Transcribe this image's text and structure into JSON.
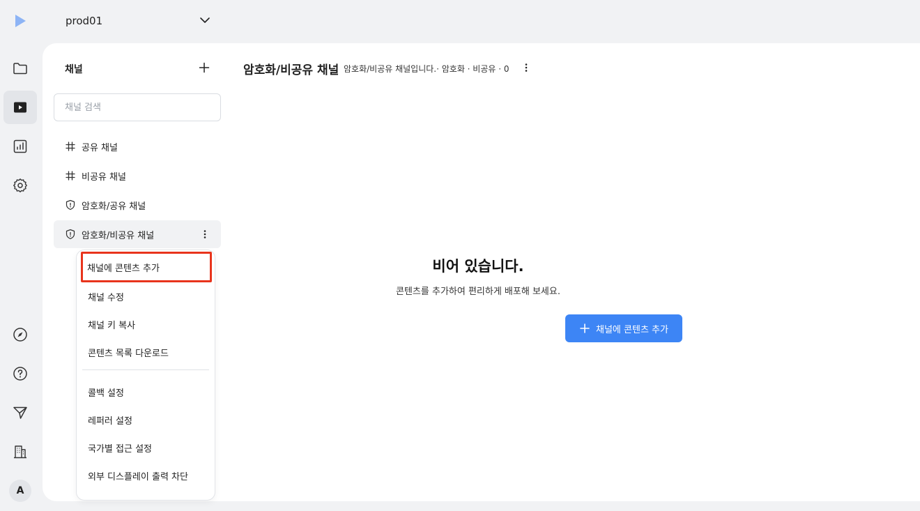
{
  "workspace": {
    "name": "prod01"
  },
  "rail": {
    "items": [
      {
        "icon": "folder-icon"
      },
      {
        "icon": "play-icon",
        "active": true
      },
      {
        "icon": "analytics-icon"
      },
      {
        "icon": "settings-icon"
      },
      {
        "icon": "compass-icon"
      },
      {
        "icon": "help-icon"
      },
      {
        "icon": "send-icon"
      },
      {
        "icon": "building-icon"
      }
    ],
    "avatar": "A"
  },
  "channels": {
    "header": "채널",
    "search_placeholder": "채널 검색",
    "items": [
      {
        "label": "공유 채널",
        "icon": "hash-icon"
      },
      {
        "label": "비공유 채널",
        "icon": "hash-icon"
      },
      {
        "label": "암호화/공유 채널",
        "icon": "shield-icon"
      },
      {
        "label": "암호화/비공유 채널",
        "icon": "shield-icon",
        "selected": true
      }
    ]
  },
  "context_menu": {
    "items": [
      "채널에 콘텐츠 추가",
      "채널 수정",
      "채널 키 복사",
      "콘텐츠 목록 다운로드",
      "콜백 설정",
      "레퍼러 설정",
      "국가별 접근 설정",
      "외부 디스플레이 출력 차단"
    ]
  },
  "content": {
    "title": "암호화/비공유 채널",
    "subtitle": "암호화/비공유 채널입니다.· 암호화 · 비공유 · 0",
    "empty_title": "비어 있습니다.",
    "empty_desc": "콘텐츠를 추가하여 편리하게 배포해 보세요.",
    "cta_label": "채널에 콘텐츠 추가"
  },
  "colors": {
    "accent": "#3d85f5",
    "highlight": "#e8341c"
  }
}
